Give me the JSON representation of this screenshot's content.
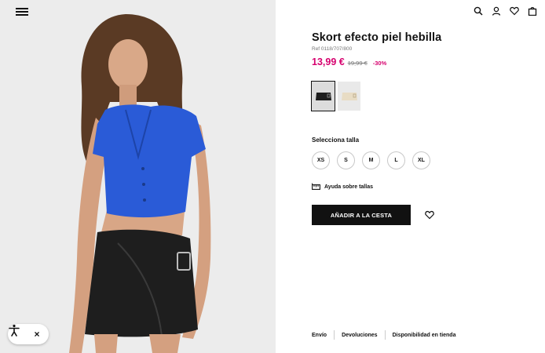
{
  "header": {
    "menu_icon": "hamburger-menu-icon",
    "icons": [
      "search-icon",
      "user-icon",
      "heart-icon",
      "bag-icon"
    ]
  },
  "product": {
    "title": "Skort efecto piel hebilla",
    "ref": "Ref 0118/707/800",
    "price_now": "13,99 €",
    "price_old": "19,99 €",
    "discount": "-30%"
  },
  "colors": {
    "price_accent": "#d6006e",
    "button_bg": "#111111",
    "image_bg": "#ececec",
    "top_blue": "#2a5bd7"
  },
  "swatches": [
    {
      "name": "black",
      "selected": true
    },
    {
      "name": "cream",
      "selected": false
    }
  ],
  "sizes": {
    "label": "Selecciona talla",
    "options": [
      "XS",
      "S",
      "M",
      "L",
      "XL"
    ]
  },
  "help": {
    "label": "Ayuda sobre tallas",
    "icon": "ruler-icon"
  },
  "cart": {
    "add_label": "AÑADIR A LA CESTA",
    "wishlist_icon": "heart-icon"
  },
  "footer": {
    "links": [
      "Envío",
      "Devoluciones",
      "Disponibilidad en tienda"
    ]
  },
  "accessibility": {
    "icon": "accessibility-icon",
    "close": "×"
  }
}
